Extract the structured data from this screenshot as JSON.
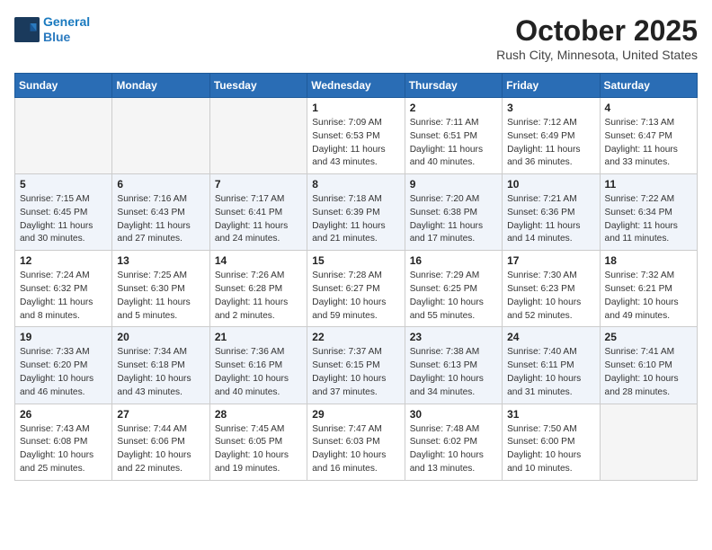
{
  "header": {
    "logo_line1": "General",
    "logo_line2": "Blue",
    "month": "October 2025",
    "location": "Rush City, Minnesota, United States"
  },
  "days_of_week": [
    "Sunday",
    "Monday",
    "Tuesday",
    "Wednesday",
    "Thursday",
    "Friday",
    "Saturday"
  ],
  "weeks": [
    [
      {
        "day": "",
        "info": ""
      },
      {
        "day": "",
        "info": ""
      },
      {
        "day": "",
        "info": ""
      },
      {
        "day": "1",
        "info": "Sunrise: 7:09 AM\nSunset: 6:53 PM\nDaylight: 11 hours and 43 minutes."
      },
      {
        "day": "2",
        "info": "Sunrise: 7:11 AM\nSunset: 6:51 PM\nDaylight: 11 hours and 40 minutes."
      },
      {
        "day": "3",
        "info": "Sunrise: 7:12 AM\nSunset: 6:49 PM\nDaylight: 11 hours and 36 minutes."
      },
      {
        "day": "4",
        "info": "Sunrise: 7:13 AM\nSunset: 6:47 PM\nDaylight: 11 hours and 33 minutes."
      }
    ],
    [
      {
        "day": "5",
        "info": "Sunrise: 7:15 AM\nSunset: 6:45 PM\nDaylight: 11 hours and 30 minutes."
      },
      {
        "day": "6",
        "info": "Sunrise: 7:16 AM\nSunset: 6:43 PM\nDaylight: 11 hours and 27 minutes."
      },
      {
        "day": "7",
        "info": "Sunrise: 7:17 AM\nSunset: 6:41 PM\nDaylight: 11 hours and 24 minutes."
      },
      {
        "day": "8",
        "info": "Sunrise: 7:18 AM\nSunset: 6:39 PM\nDaylight: 11 hours and 21 minutes."
      },
      {
        "day": "9",
        "info": "Sunrise: 7:20 AM\nSunset: 6:38 PM\nDaylight: 11 hours and 17 minutes."
      },
      {
        "day": "10",
        "info": "Sunrise: 7:21 AM\nSunset: 6:36 PM\nDaylight: 11 hours and 14 minutes."
      },
      {
        "day": "11",
        "info": "Sunrise: 7:22 AM\nSunset: 6:34 PM\nDaylight: 11 hours and 11 minutes."
      }
    ],
    [
      {
        "day": "12",
        "info": "Sunrise: 7:24 AM\nSunset: 6:32 PM\nDaylight: 11 hours and 8 minutes."
      },
      {
        "day": "13",
        "info": "Sunrise: 7:25 AM\nSunset: 6:30 PM\nDaylight: 11 hours and 5 minutes."
      },
      {
        "day": "14",
        "info": "Sunrise: 7:26 AM\nSunset: 6:28 PM\nDaylight: 11 hours and 2 minutes."
      },
      {
        "day": "15",
        "info": "Sunrise: 7:28 AM\nSunset: 6:27 PM\nDaylight: 10 hours and 59 minutes."
      },
      {
        "day": "16",
        "info": "Sunrise: 7:29 AM\nSunset: 6:25 PM\nDaylight: 10 hours and 55 minutes."
      },
      {
        "day": "17",
        "info": "Sunrise: 7:30 AM\nSunset: 6:23 PM\nDaylight: 10 hours and 52 minutes."
      },
      {
        "day": "18",
        "info": "Sunrise: 7:32 AM\nSunset: 6:21 PM\nDaylight: 10 hours and 49 minutes."
      }
    ],
    [
      {
        "day": "19",
        "info": "Sunrise: 7:33 AM\nSunset: 6:20 PM\nDaylight: 10 hours and 46 minutes."
      },
      {
        "day": "20",
        "info": "Sunrise: 7:34 AM\nSunset: 6:18 PM\nDaylight: 10 hours and 43 minutes."
      },
      {
        "day": "21",
        "info": "Sunrise: 7:36 AM\nSunset: 6:16 PM\nDaylight: 10 hours and 40 minutes."
      },
      {
        "day": "22",
        "info": "Sunrise: 7:37 AM\nSunset: 6:15 PM\nDaylight: 10 hours and 37 minutes."
      },
      {
        "day": "23",
        "info": "Sunrise: 7:38 AM\nSunset: 6:13 PM\nDaylight: 10 hours and 34 minutes."
      },
      {
        "day": "24",
        "info": "Sunrise: 7:40 AM\nSunset: 6:11 PM\nDaylight: 10 hours and 31 minutes."
      },
      {
        "day": "25",
        "info": "Sunrise: 7:41 AM\nSunset: 6:10 PM\nDaylight: 10 hours and 28 minutes."
      }
    ],
    [
      {
        "day": "26",
        "info": "Sunrise: 7:43 AM\nSunset: 6:08 PM\nDaylight: 10 hours and 25 minutes."
      },
      {
        "day": "27",
        "info": "Sunrise: 7:44 AM\nSunset: 6:06 PM\nDaylight: 10 hours and 22 minutes."
      },
      {
        "day": "28",
        "info": "Sunrise: 7:45 AM\nSunset: 6:05 PM\nDaylight: 10 hours and 19 minutes."
      },
      {
        "day": "29",
        "info": "Sunrise: 7:47 AM\nSunset: 6:03 PM\nDaylight: 10 hours and 16 minutes."
      },
      {
        "day": "30",
        "info": "Sunrise: 7:48 AM\nSunset: 6:02 PM\nDaylight: 10 hours and 13 minutes."
      },
      {
        "day": "31",
        "info": "Sunrise: 7:50 AM\nSunset: 6:00 PM\nDaylight: 10 hours and 10 minutes."
      },
      {
        "day": "",
        "info": ""
      }
    ]
  ]
}
